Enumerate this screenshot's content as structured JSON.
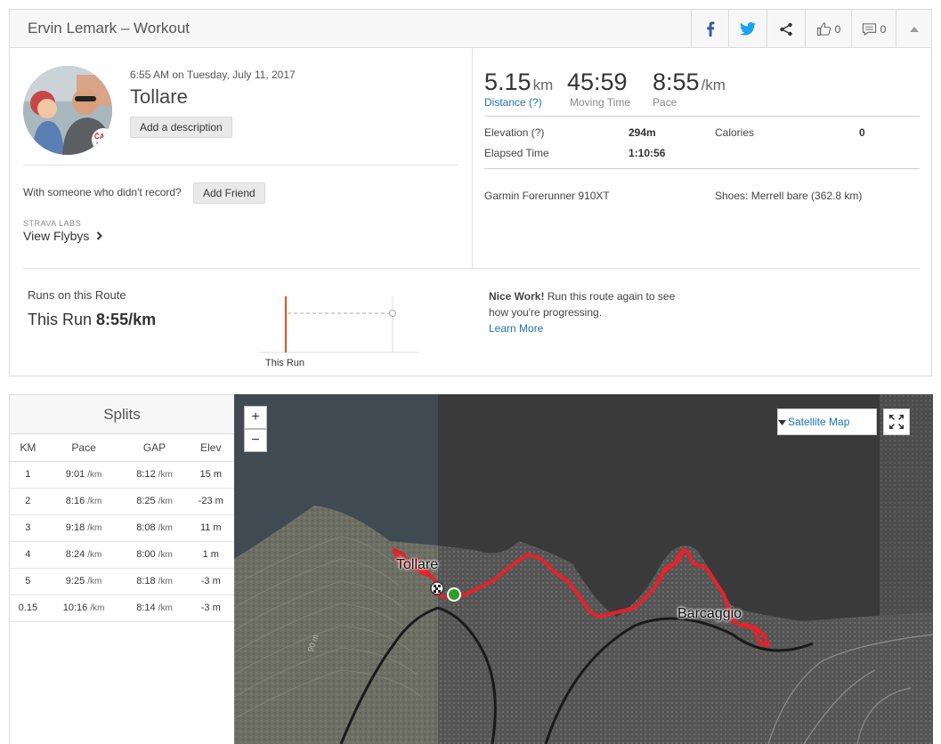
{
  "header": {
    "title": "Ervin Lemark – Workout",
    "kudos_count": "0",
    "comments_count": "0"
  },
  "activity": {
    "date": "6:55 AM on Tuesday, July 11, 2017",
    "name": "Tollare",
    "add_description": "Add a description",
    "with_someone": "With someone who didn't record?",
    "add_friend": "Add Friend",
    "labs_label": "STRAVA LABS",
    "view_flybys": "View Flybys"
  },
  "stats": {
    "distance_value": "5.15",
    "distance_unit": "km",
    "distance_label": "Distance (?)",
    "moving_time_value": "45:59",
    "moving_time_label": "Moving Time",
    "pace_value": "8:55",
    "pace_unit": "/km",
    "pace_label": "Pace",
    "elevation_label": "Elevation (?)",
    "elevation_value": "294m",
    "calories_label": "Calories",
    "calories_value": "0",
    "elapsed_label": "Elapsed Time",
    "elapsed_value": "1:10:56",
    "device": "Garmin Forerunner 910XT",
    "shoes": "Shoes: Merrell bare (362.8 km)"
  },
  "route": {
    "runs_label": "Runs on this Route",
    "this_run_label": "This Run",
    "this_run_pace": "8:55/km",
    "chart_axis_label": "This Run",
    "nice_work_bold": "Nice Work!",
    "nice_work_text": "Run this route again to see how you're progressing.",
    "learn_more": "Learn More"
  },
  "splits": {
    "title": "Splits",
    "headers": [
      "KM",
      "Pace",
      "GAP",
      "Elev"
    ],
    "rows": [
      {
        "km": "1",
        "pace": "9:01",
        "pace_unit": "/km",
        "gap": "8:12",
        "gap_unit": "/km",
        "elev": "15 m"
      },
      {
        "km": "2",
        "pace": "8:16",
        "pace_unit": "/km",
        "gap": "8:25",
        "gap_unit": "/km",
        "elev": "-23 m"
      },
      {
        "km": "3",
        "pace": "9:18",
        "pace_unit": "/km",
        "gap": "8:08",
        "gap_unit": "/km",
        "elev": "11 m"
      },
      {
        "km": "4",
        "pace": "8:24",
        "pace_unit": "/km",
        "gap": "8:00",
        "gap_unit": "/km",
        "elev": "1 m"
      },
      {
        "km": "5",
        "pace": "9:25",
        "pace_unit": "/km",
        "gap": "8:18",
        "gap_unit": "/km",
        "elev": "-3 m"
      },
      {
        "km": "0.15",
        "pace": "10:16",
        "pace_unit": "/km",
        "gap": "8:14",
        "gap_unit": "/km",
        "elev": "-3 m"
      }
    ]
  },
  "map": {
    "zoom_in": "+",
    "zoom_out": "−",
    "map_type": "Satellite Map",
    "place_1": "Tollare",
    "place_2": "Barcaggio",
    "contour_label": "90 m",
    "route_color": "#e8202a",
    "start_color": "#2e9e2a"
  },
  "colors": {
    "link": "#1a73b8",
    "accent": "#fc4c02"
  }
}
